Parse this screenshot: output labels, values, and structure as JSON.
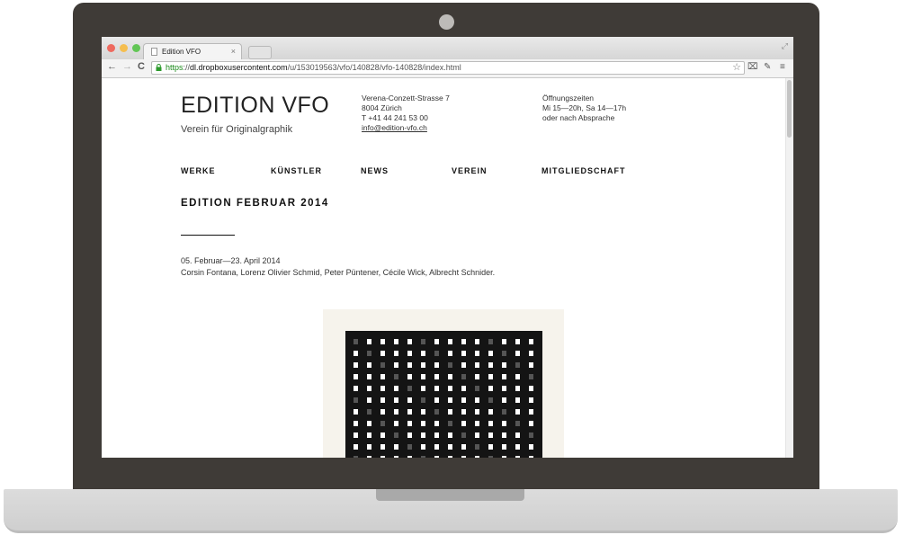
{
  "browser": {
    "tab_title": "Edition VFO",
    "tab_close": "×",
    "url_scheme": "https",
    "url_separator": "://",
    "url_host": "dl.dropboxusercontent.com",
    "url_path": "/u/153019563/vfo/140828/vfo-140828/index.html",
    "back": "←",
    "forward": "→",
    "reload": "C",
    "bookmark_star": "☆",
    "menu": "≡",
    "traffic_light_colors": [
      "#ee6a5f",
      "#f5be4f",
      "#62c655"
    ]
  },
  "site": {
    "logo": "EDITION VFO",
    "subtitle": "Verein für Originalgraphik",
    "address": {
      "street": "Verena-Conzett-Strasse 7",
      "city": "8004 Zürich",
      "phone": "T +41 44 241 53 00",
      "email": "info@edition-vfo.ch"
    },
    "hours": {
      "label": "Öffnungszeiten",
      "times": "Mi 15—20h, Sa 14—17h",
      "note": "oder nach Absprache"
    },
    "nav": [
      "WERKE",
      "KÜNSTLER",
      "NEWS",
      "VEREIN",
      "MITGLIEDSCHAFT"
    ],
    "heading": "EDITION FEBRUAR 2014",
    "dates": "05. Februar—23. April 2014",
    "artists": "Corsin Fontana, Lorenz Olivier Schmid, Peter Püntener, Cécile Wick, Albrecht Schnider."
  }
}
